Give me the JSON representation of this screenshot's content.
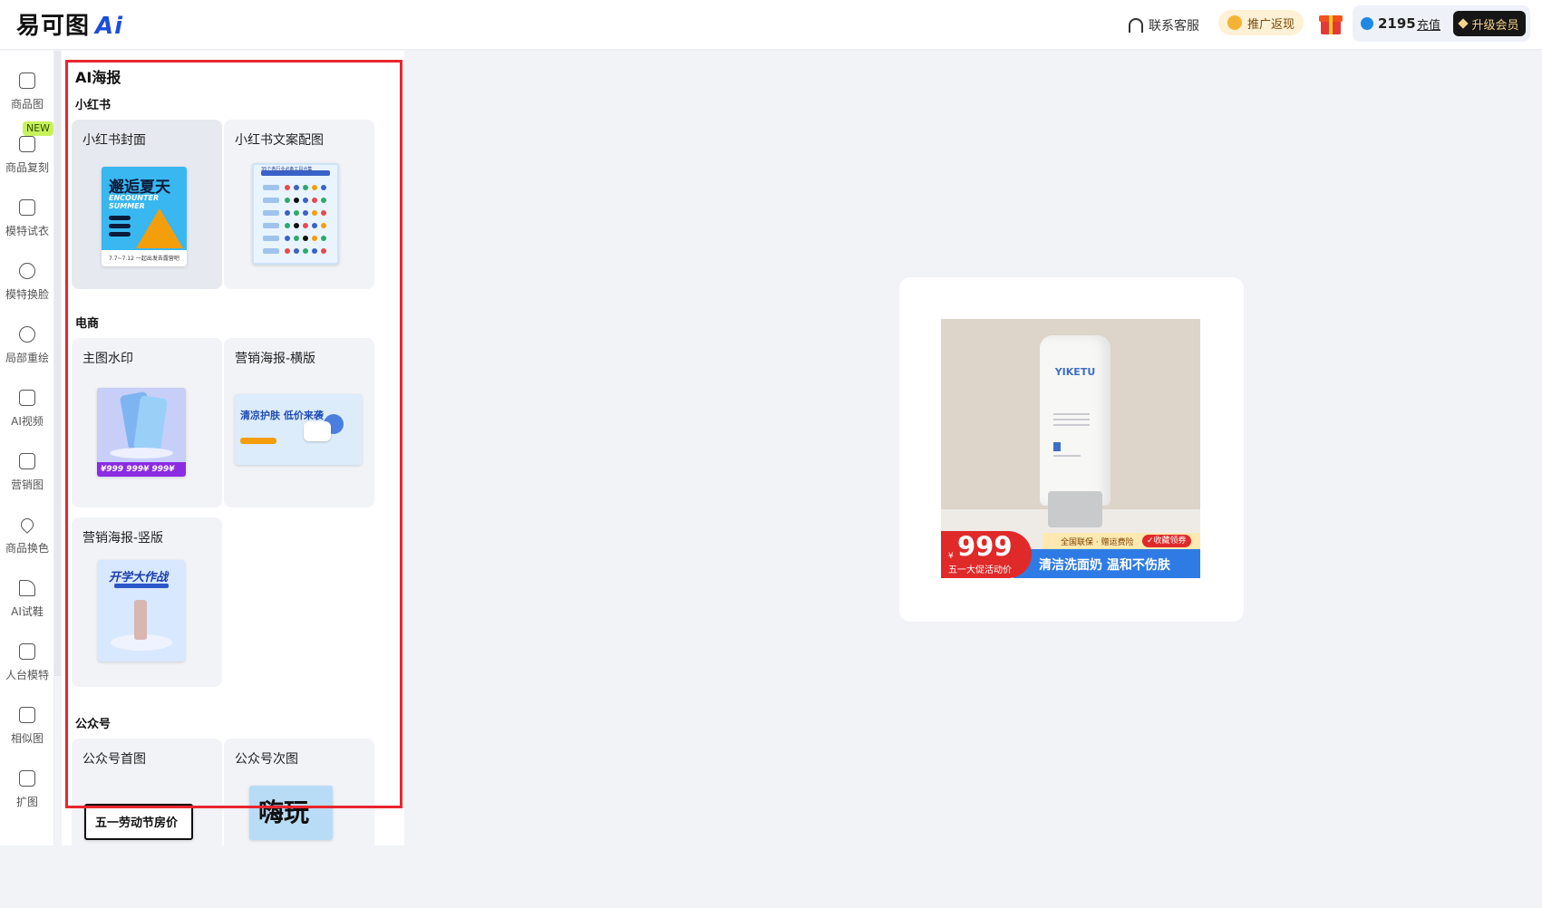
{
  "header": {
    "logo_text": "易可图",
    "logo_ai": "Ai",
    "contact": "联系客服",
    "promo": "推广返现",
    "credits": "2195",
    "recharge": "充值",
    "upgrade": "升级会员"
  },
  "rail": {
    "new_badge": "NEW",
    "items": [
      {
        "label": "商品图",
        "icon": "product-image-icon"
      },
      {
        "label": "商品复刻",
        "icon": "product-copy-icon"
      },
      {
        "label": "模特试衣",
        "icon": "tshirt-icon"
      },
      {
        "label": "模特换脸",
        "icon": "face-swap-icon"
      },
      {
        "label": "局部重绘",
        "icon": "repaint-icon"
      },
      {
        "label": "AI视频",
        "icon": "video-icon"
      },
      {
        "label": "营销图",
        "icon": "marketing-icon"
      },
      {
        "label": "商品换色",
        "icon": "color-drop-icon"
      },
      {
        "label": "AI试鞋",
        "icon": "shoe-icon"
      },
      {
        "label": "人台模特",
        "icon": "mannequin-icon"
      },
      {
        "label": "相似图",
        "icon": "similar-image-icon"
      },
      {
        "label": "扩图",
        "icon": "expand-image-icon"
      }
    ]
  },
  "panel": {
    "title": "AI海报",
    "sections": [
      {
        "title": "小红书",
        "cards": [
          "小红书封面",
          "小红书文案配图"
        ]
      },
      {
        "title": "电商",
        "cards": [
          "主图水印",
          "营销海报-横版",
          "营销海报-竖版"
        ]
      },
      {
        "title": "公众号",
        "cards": [
          "公众号首图",
          "公众号次图"
        ]
      }
    ],
    "thumbs": {
      "summer_title": "邂逅夏天",
      "summer_sub": "ENCOUNTER SUMMER",
      "summer_date": "7.7~7.12 一起出发去露营吧",
      "doc_title": "35个各行业必备工具合集",
      "phone_price": "¥999 999¥ 999¥ 999",
      "skin_title": "清凉护肤 低价来袭",
      "school_title": "开学大作战",
      "wx1_title": "五一劳动节房价",
      "wx2_title": "嗨玩"
    }
  },
  "canvas": {
    "brand": "YIKETU",
    "yen": "¥",
    "price": "999",
    "price_sub": "五一大促活动价",
    "tag1": "全国联保 · 赠运费险",
    "tag2": "✓收藏领券",
    "slogan": "清洁洗面奶 温和不伤肤"
  }
}
